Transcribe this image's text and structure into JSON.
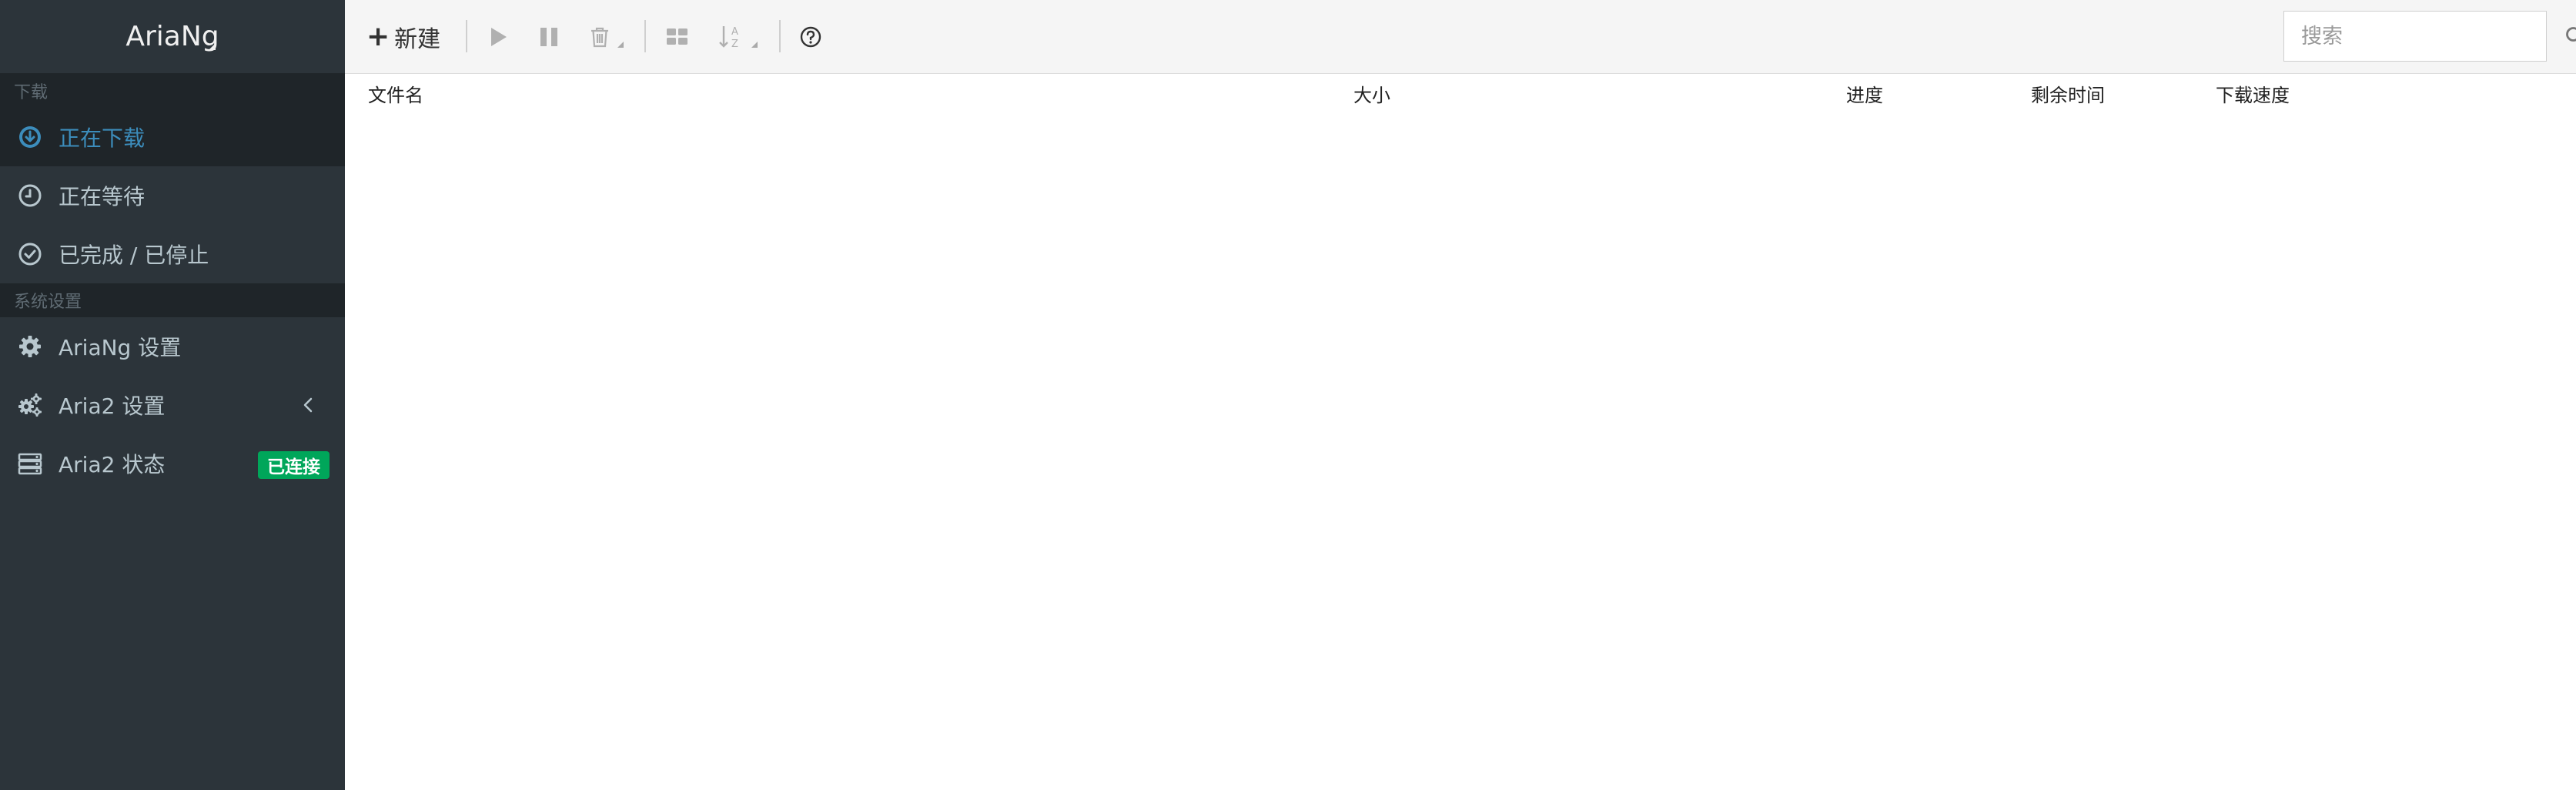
{
  "app": {
    "brand": "AriaNg"
  },
  "sidebar": {
    "download_header": "下载",
    "download_items": [
      {
        "label": "正在下载",
        "icon": "arrow-circle-down-icon",
        "active": true
      },
      {
        "label": "正在等待",
        "icon": "clock-icon",
        "active": false
      },
      {
        "label": "已完成 / 已停止",
        "icon": "check-circle-icon",
        "active": false
      }
    ],
    "settings_header": "系统设置",
    "settings_items": [
      {
        "label": "AriaNg 设置",
        "icon": "gear-icon"
      },
      {
        "label": "Aria2 设置",
        "icon": "gears-icon",
        "expand_icon": "chevron-left-icon"
      },
      {
        "label": "Aria2 状态",
        "icon": "server-icon",
        "badge": "已连接"
      }
    ]
  },
  "toolbar": {
    "new_label": "新建",
    "buttons": [
      "play-icon",
      "pause-icon",
      "trash-icon",
      "grid-icon",
      "sort-icon",
      "help-icon"
    ],
    "search_placeholder": "搜索"
  },
  "table": {
    "columns": [
      "文件名",
      "大小",
      "进度",
      "剩余时间",
      "下载速度"
    ],
    "rows": []
  },
  "colors": {
    "sidebar_bg": "#2c343a",
    "sidebar_active_bg": "#1f2529",
    "active_accent": "#3c8dbc",
    "badge_green": "#00a65a",
    "toolbar_bg": "#f5f5f5"
  }
}
